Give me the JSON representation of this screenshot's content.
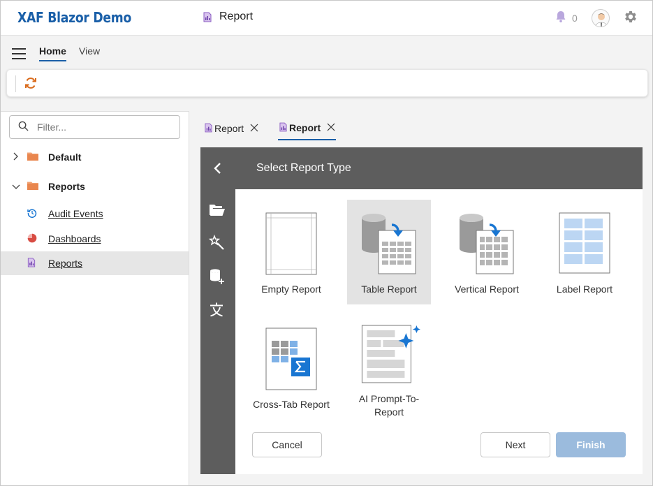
{
  "app": {
    "title": "XAF Blazor Demo"
  },
  "header": {
    "current_view": "Report",
    "notifications_count": "0"
  },
  "nav": {
    "tabs": [
      {
        "label": "Home"
      },
      {
        "label": "View"
      }
    ]
  },
  "sidebar": {
    "filter_placeholder": "Filter...",
    "groups": [
      {
        "label": "Default",
        "expanded": false
      },
      {
        "label": "Reports",
        "expanded": true
      }
    ],
    "items": [
      {
        "label": "Audit Events",
        "icon": "history-icon"
      },
      {
        "label": "Dashboards",
        "icon": "pie-chart-icon"
      },
      {
        "label": "Reports",
        "icon": "report-icon",
        "selected": true
      }
    ]
  },
  "doc_tabs": [
    {
      "label": "Report",
      "active": false
    },
    {
      "label": "Report",
      "active": true
    }
  ],
  "wizard": {
    "title": "Select Report Type",
    "report_types": [
      {
        "label": "Empty Report"
      },
      {
        "label": "Table Report",
        "selected": true
      },
      {
        "label": "Vertical Report"
      },
      {
        "label": "Label Report"
      },
      {
        "label": "Cross-Tab Report"
      },
      {
        "label": "AI Prompt-To-\nReport"
      }
    ],
    "buttons": {
      "cancel": "Cancel",
      "next": "Next",
      "finish": "Finish"
    }
  },
  "colors": {
    "brand": "#1a5fa8",
    "wizard_header": "#5d5d5d",
    "finish_disabled": "#9bbbdd",
    "accent_blue": "#1976d2"
  }
}
